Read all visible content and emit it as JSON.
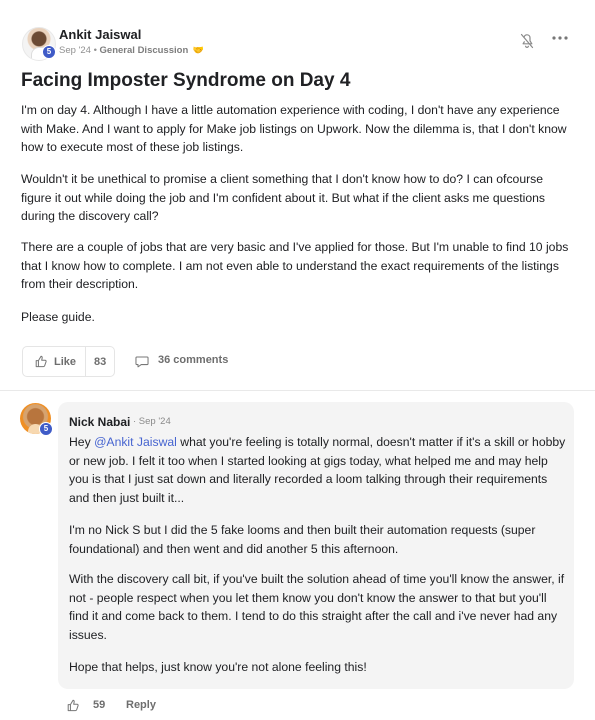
{
  "post": {
    "author": "Ankit Jaiswal",
    "level": "5",
    "date": "Sep '24",
    "separator": "•",
    "category": "General Discussion",
    "category_emoji": "🤝",
    "title": "Facing Imposter Syndrome on Day 4",
    "paragraphs": [
      "I'm on day 4. Although I have a little automation experience with coding, I don't have any experience with Make. And I want to apply for Make job listings on Upwork. Now the dilemma is, that I don't know how to execute most of these job listings.",
      "Wouldn't it be unethical to promise a client something that I don't know how to do? I can ofcourse figure it out while doing the job and I'm confident about it. But what if the client asks me questions during the discovery call?",
      "There are a couple of jobs that are very basic and I've applied for those. But I'm unable to find 10 jobs that I know how to complete. I am not even able to understand the exact requirements of the listings from their description.",
      "Please guide."
    ],
    "like_label": "Like",
    "like_count": "83",
    "comments_label": "36 comments",
    "icons": {
      "notification": "bell-off-icon",
      "more": "more-horizontal-icon",
      "like": "thumbs-up-icon",
      "comments": "comment-bubble-icon"
    }
  },
  "comment": {
    "author": "Nick Nabai",
    "level": "5",
    "date": "· Sep '24",
    "mention": "@Ankit Jaiswal",
    "first_paragraph_prefix": "Hey ",
    "first_paragraph_suffix": " what you're feeling is totally normal, doesn't matter if it's a skill or hobby or new job. I felt it too when I started looking at gigs today, what helped me and may help you is that I just sat down and literally recorded a loom talking through their requirements and then just built it...",
    "paragraphs": [
      "I'm no Nick S but I did the 5 fake looms and then built their automation requests (super foundational) and then went and did another 5 this afternoon.",
      "With the discovery call bit, if you've built the solution ahead of time you'll know the answer, if not - people respect when you let them know you don't know the answer to that but you'll find it and come back to them. I tend to do this straight after the call and i've never had any issues.",
      "Hope that helps, just know you're not alone feeling this!"
    ],
    "like_count": "59",
    "reply_label": "Reply",
    "icons": {
      "like": "thumbs-up-icon"
    }
  },
  "colors": {
    "text": "#202124",
    "muted": "#6e6e6e",
    "mention": "#4664d0",
    "badge": "#3f5bc7",
    "comment_background": "#f4f4f4",
    "border": "#e5e5e5"
  }
}
